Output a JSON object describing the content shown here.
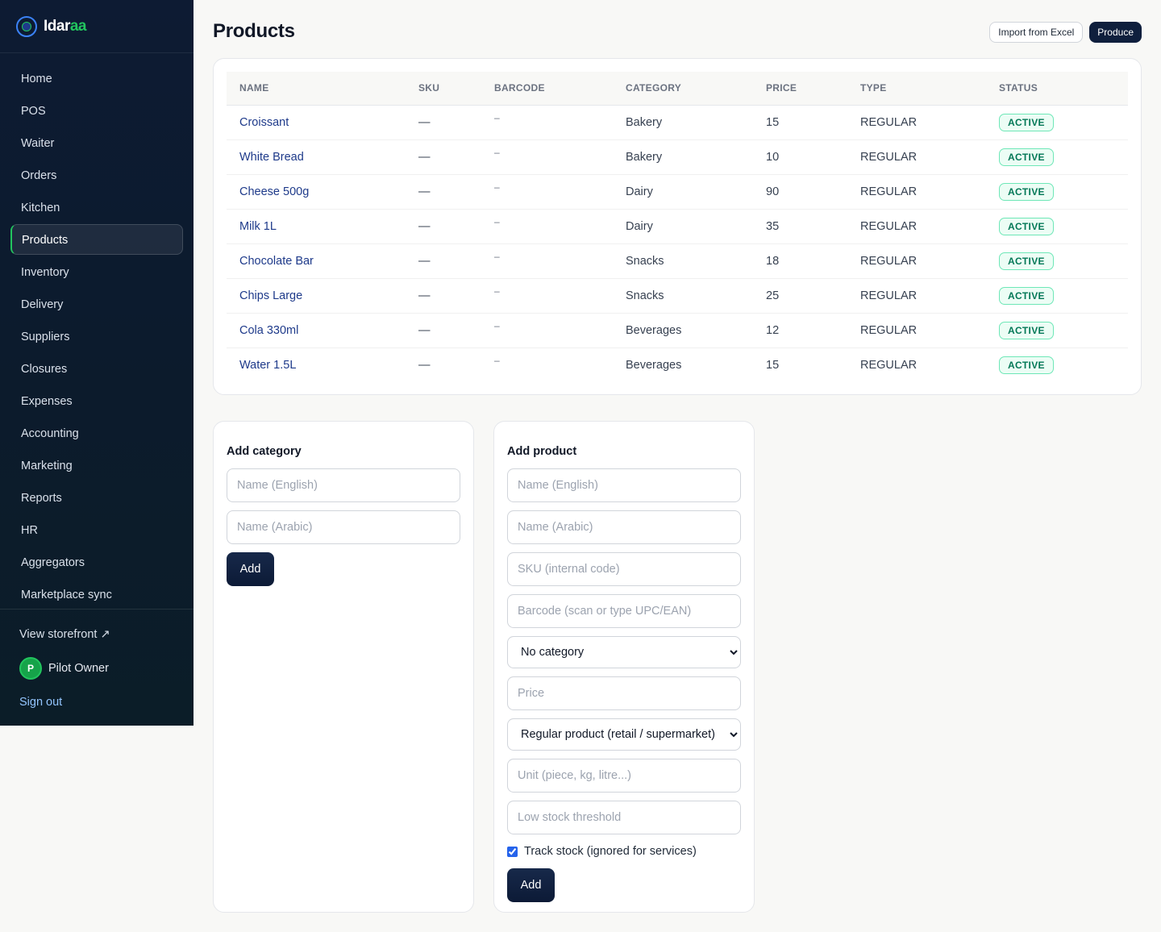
{
  "brand": {
    "name_main": "Idar",
    "name_accent": "aa"
  },
  "sidebar": {
    "items": [
      {
        "label": "Home"
      },
      {
        "label": "POS"
      },
      {
        "label": "Waiter"
      },
      {
        "label": "Orders"
      },
      {
        "label": "Kitchen"
      },
      {
        "label": "Products"
      },
      {
        "label": "Inventory"
      },
      {
        "label": "Delivery"
      },
      {
        "label": "Suppliers"
      },
      {
        "label": "Closures"
      },
      {
        "label": "Expenses"
      },
      {
        "label": "Accounting"
      },
      {
        "label": "Marketing"
      },
      {
        "label": "Reports"
      },
      {
        "label": "HR"
      },
      {
        "label": "Aggregators"
      },
      {
        "label": "Marketplace sync"
      }
    ],
    "active_item": "Products",
    "storefront_label": "View storefront ↗",
    "user": {
      "initial": "P",
      "name": "Pilot Owner"
    },
    "signout_label": "Sign out"
  },
  "header": {
    "title": "Products",
    "import_label": "Import from Excel",
    "produce_label": "Produce"
  },
  "table": {
    "columns": [
      "NAME",
      "SKU",
      "BARCODE",
      "CATEGORY",
      "PRICE",
      "TYPE",
      "STATUS"
    ],
    "rows": [
      {
        "name": "Croissant",
        "sku": "—",
        "barcode": "–",
        "category": "Bakery",
        "price": "15",
        "type": "REGULAR",
        "status": "ACTIVE"
      },
      {
        "name": "White Bread",
        "sku": "—",
        "barcode": "–",
        "category": "Bakery",
        "price": "10",
        "type": "REGULAR",
        "status": "ACTIVE"
      },
      {
        "name": "Cheese 500g",
        "sku": "—",
        "barcode": "–",
        "category": "Dairy",
        "price": "90",
        "type": "REGULAR",
        "status": "ACTIVE"
      },
      {
        "name": "Milk 1L",
        "sku": "—",
        "barcode": "–",
        "category": "Dairy",
        "price": "35",
        "type": "REGULAR",
        "status": "ACTIVE"
      },
      {
        "name": "Chocolate Bar",
        "sku": "—",
        "barcode": "–",
        "category": "Snacks",
        "price": "18",
        "type": "REGULAR",
        "status": "ACTIVE"
      },
      {
        "name": "Chips Large",
        "sku": "—",
        "barcode": "–",
        "category": "Snacks",
        "price": "25",
        "type": "REGULAR",
        "status": "ACTIVE"
      },
      {
        "name": "Cola 330ml",
        "sku": "—",
        "barcode": "–",
        "category": "Beverages",
        "price": "12",
        "type": "REGULAR",
        "status": "ACTIVE"
      },
      {
        "name": "Water 1.5L",
        "sku": "—",
        "barcode": "–",
        "category": "Beverages",
        "price": "15",
        "type": "REGULAR",
        "status": "ACTIVE"
      }
    ]
  },
  "add_category": {
    "title": "Add category",
    "name_en_placeholder": "Name (English)",
    "name_ar_placeholder": "Name (Arabic)",
    "submit_label": "Add"
  },
  "add_product": {
    "title": "Add product",
    "name_en_placeholder": "Name (English)",
    "name_ar_placeholder": "Name (Arabic)",
    "sku_placeholder": "SKU (internal code)",
    "barcode_placeholder": "Barcode (scan or type UPC/EAN)",
    "category_value": "No category",
    "price_placeholder": "Price",
    "type_value": "Regular product (retail / supermarket)",
    "unit_placeholder": "Unit (piece, kg, litre...)",
    "threshold_placeholder": "Low stock threshold",
    "track_stock_label": "Track stock (ignored for services)",
    "track_stock_checked": true,
    "submit_label": "Add"
  },
  "colors": {
    "sidebar_bg": "#0d1b33",
    "accent_green": "#22c55e",
    "primary_dark": "#0f1f3d",
    "link_blue": "#1e3a8a",
    "status_green": "#047857"
  }
}
